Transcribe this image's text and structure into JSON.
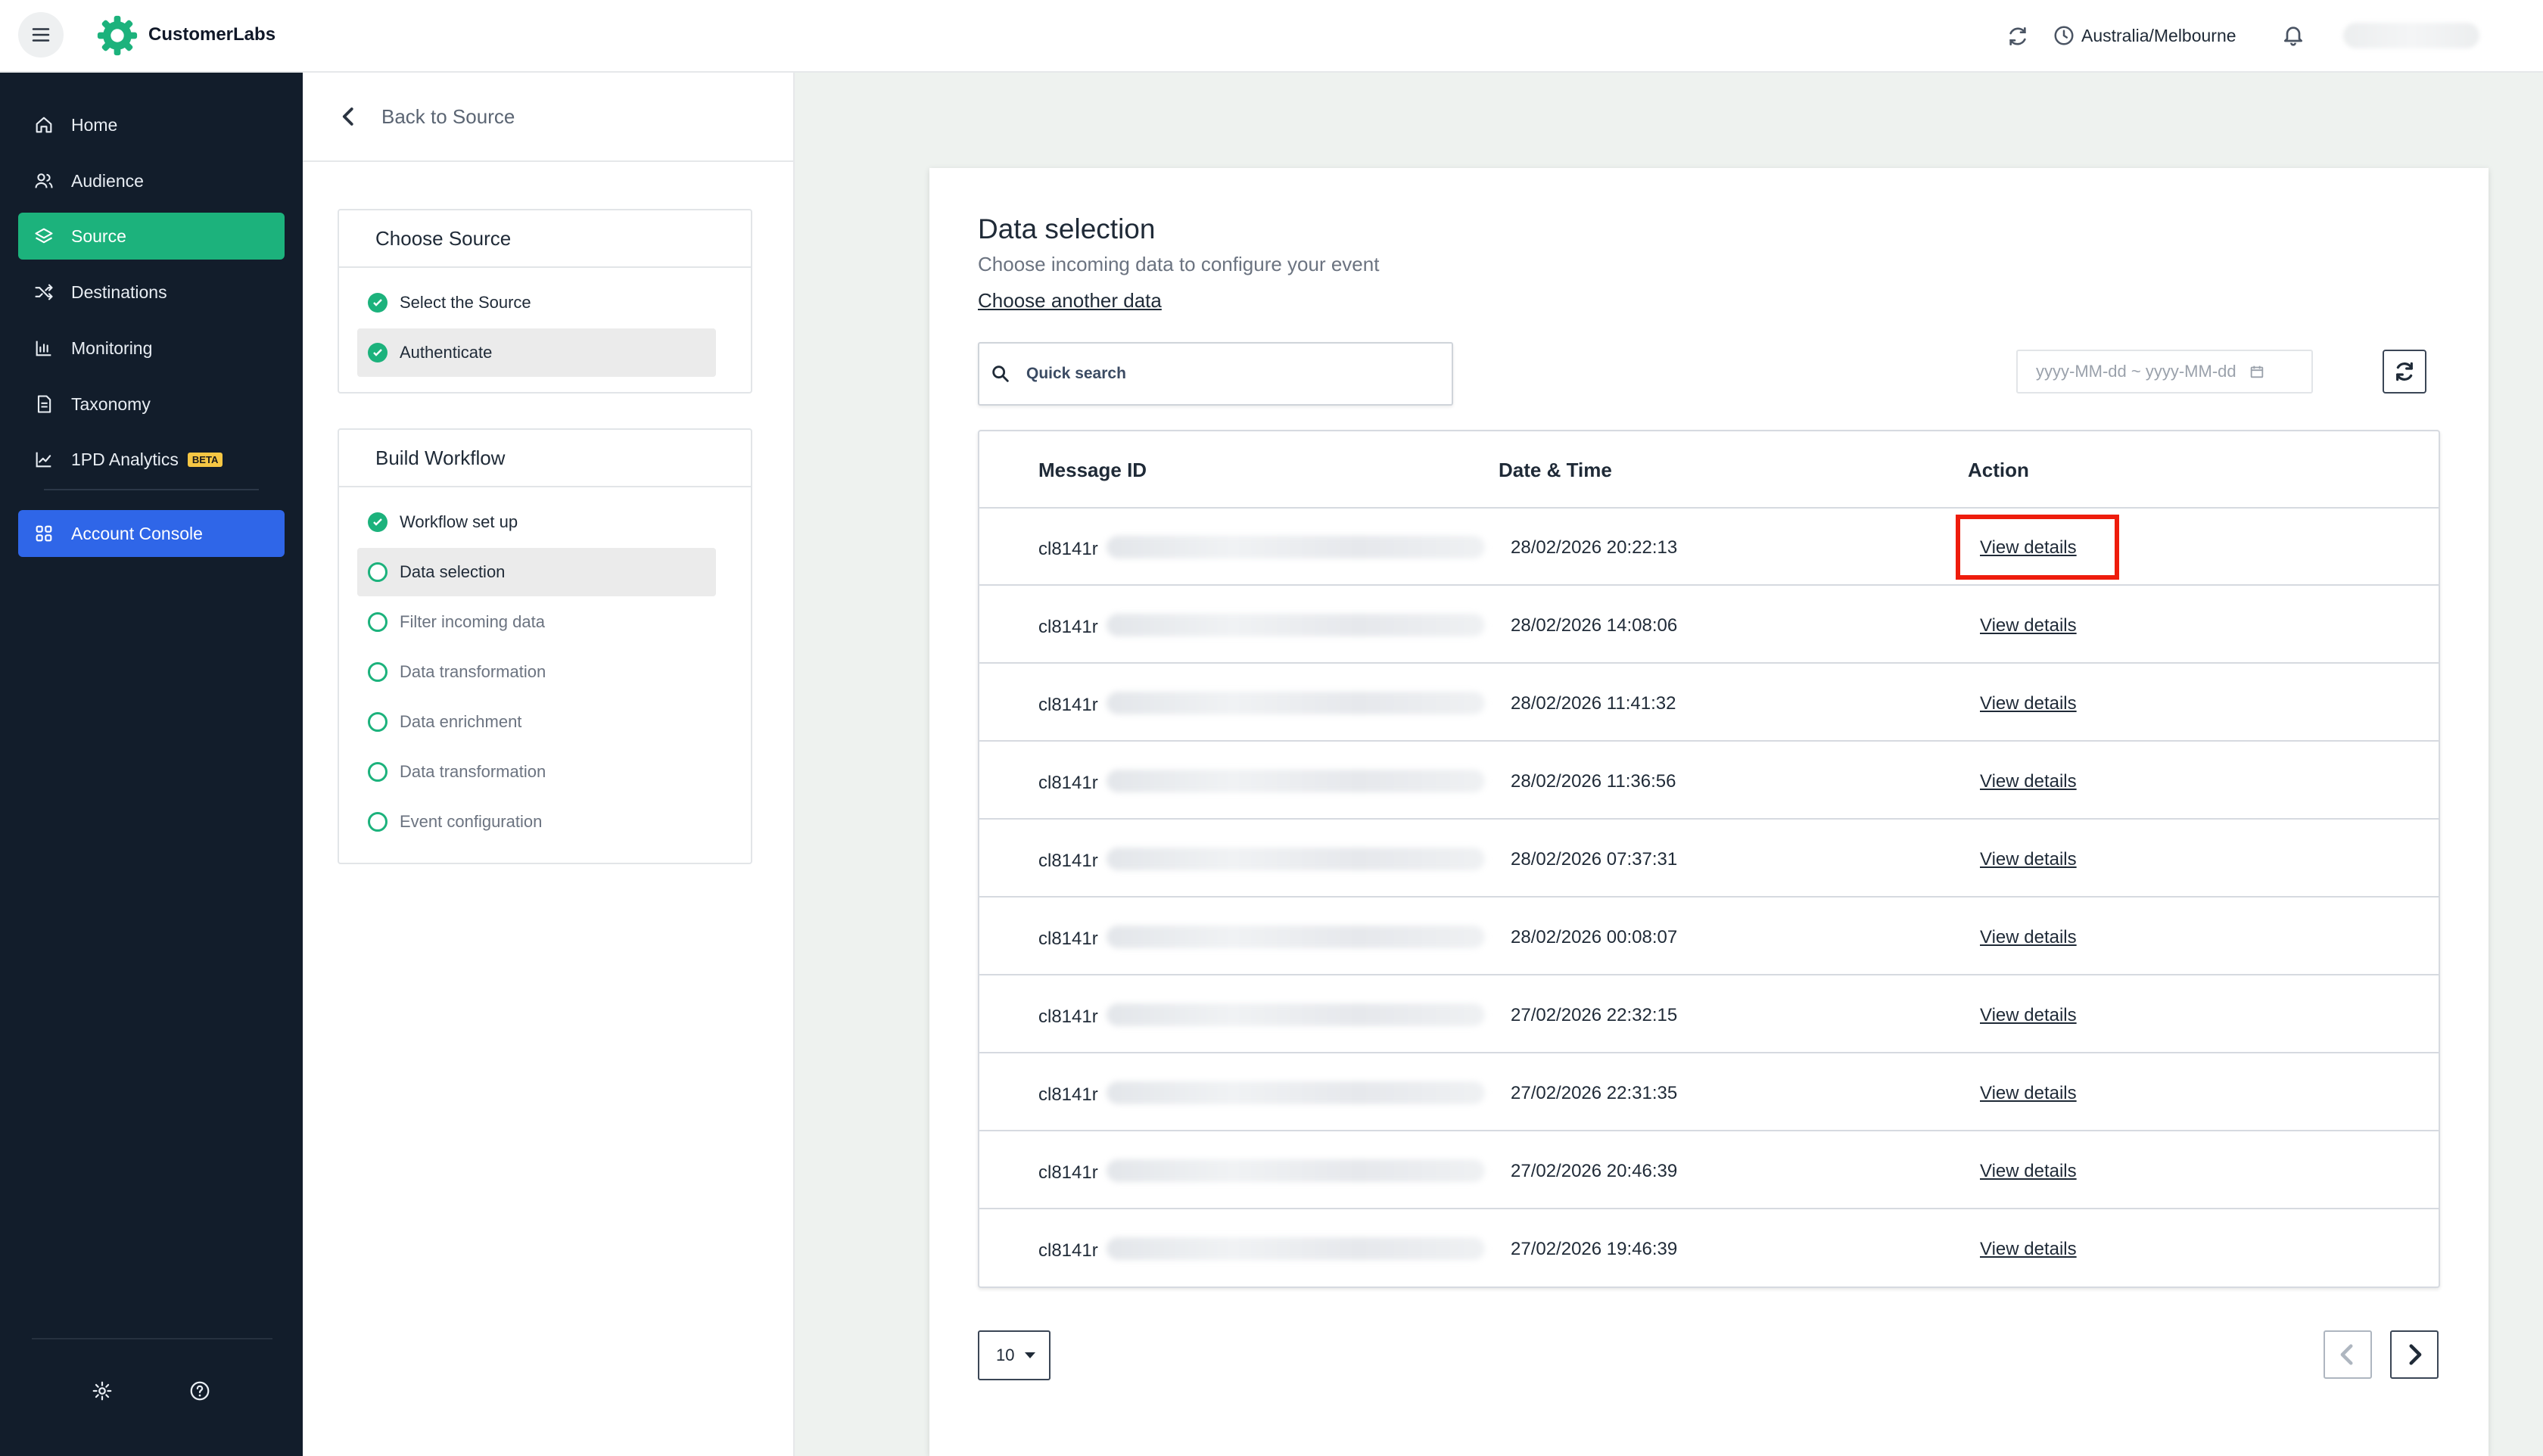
{
  "app": {
    "brand": "CustomerLabs",
    "timezone": "Australia/Melbourne",
    "accent": "#1cb27c",
    "console_color": "#2f66e8"
  },
  "nav": {
    "items": [
      {
        "label": "Home",
        "icon": "home-icon"
      },
      {
        "label": "Audience",
        "icon": "users-icon"
      },
      {
        "label": "Source",
        "icon": "layers-icon"
      },
      {
        "label": "Destinations",
        "icon": "shuffle-icon"
      },
      {
        "label": "Monitoring",
        "icon": "bar-chart-icon"
      },
      {
        "label": "Taxonomy",
        "icon": "document-icon"
      },
      {
        "label": "1PD Analytics",
        "icon": "trend-icon",
        "badge": "BETA"
      }
    ],
    "console_label": "Account Console"
  },
  "stepper": {
    "back_label": "Back to Source",
    "choose_source": {
      "title": "Choose Source",
      "steps": [
        "Select the Source",
        "Authenticate"
      ]
    },
    "build_workflow": {
      "title": "Build Workflow",
      "steps": [
        "Workflow set up",
        "Data selection",
        "Filter incoming data",
        "Data transformation",
        "Data enrichment",
        "Data transformation",
        "Event configuration"
      ]
    }
  },
  "main": {
    "title": "Data selection",
    "subtitle": "Choose incoming data to configure your event",
    "choose_another": "Choose another data",
    "search_placeholder": "Quick search",
    "date_placeholder": "yyyy-MM-dd ~ yyyy-MM-dd"
  },
  "table": {
    "headers": [
      "Message ID",
      "Date & Time",
      "Action"
    ],
    "rows": [
      {
        "id": "cl8141r",
        "datetime": "28/02/2026 20:22:13",
        "action": "View details"
      },
      {
        "id": "cl8141r",
        "datetime": "28/02/2026 14:08:06",
        "action": "View details"
      },
      {
        "id": "cl8141r",
        "datetime": "28/02/2026 11:41:32",
        "action": "View details"
      },
      {
        "id": "cl8141r",
        "datetime": "28/02/2026 11:36:56",
        "action": "View details"
      },
      {
        "id": "cl8141r",
        "datetime": "28/02/2026 07:37:31",
        "action": "View details"
      },
      {
        "id": "cl8141r",
        "datetime": "28/02/2026 00:08:07",
        "action": "View details"
      },
      {
        "id": "cl8141r",
        "datetime": "27/02/2026 22:32:15",
        "action": "View details"
      },
      {
        "id": "cl8141r",
        "datetime": "27/02/2026 22:31:35",
        "action": "View details"
      },
      {
        "id": "cl8141r",
        "datetime": "27/02/2026 20:46:39",
        "action": "View details"
      },
      {
        "id": "cl8141r",
        "datetime": "27/02/2026 19:46:39",
        "action": "View details"
      }
    ]
  },
  "pagination": {
    "page_size": "10"
  }
}
